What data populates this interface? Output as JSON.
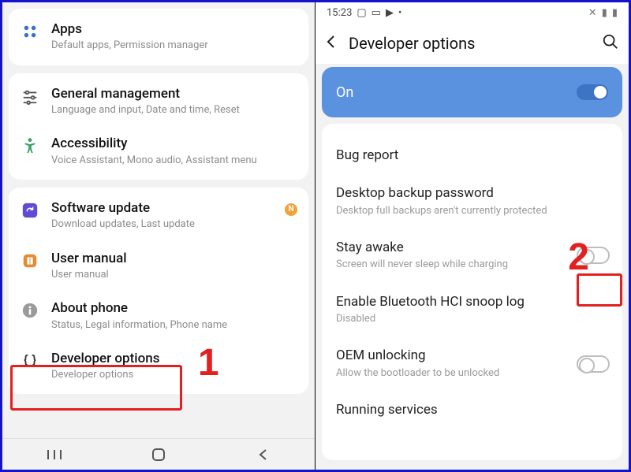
{
  "left": {
    "apps": {
      "title": "Apps",
      "sub": "Default apps, Permission manager"
    },
    "general": {
      "title": "General management",
      "sub": "Language and input, Date and time, Reset"
    },
    "accessibility": {
      "title": "Accessibility",
      "sub": "Voice Assistant, Mono audio, Assistant menu"
    },
    "software": {
      "title": "Software update",
      "sub": "Download updates, Last update",
      "badge": "N"
    },
    "manual": {
      "title": "User manual",
      "sub": "User manual"
    },
    "about": {
      "title": "About phone",
      "sub": "Status, Legal information, Phone name"
    },
    "developer": {
      "title": "Developer options",
      "sub": "Developer options"
    }
  },
  "right": {
    "status_time": "15:23",
    "appbar_title": "Developer options",
    "hero_label": "On",
    "items": {
      "bug": {
        "title": "Bug report"
      },
      "desktop": {
        "title": "Desktop backup password",
        "sub": "Desktop full backups aren't currently protected"
      },
      "stay": {
        "title": "Stay awake",
        "sub": "Screen will never sleep while charging"
      },
      "hci": {
        "title": "Enable Bluetooth HCI snoop log",
        "sub": "Disabled"
      },
      "oem": {
        "title": "OEM unlocking",
        "sub": "Allow the bootloader to be unlocked"
      },
      "running": {
        "title": "Running services"
      }
    }
  },
  "annotations": {
    "one": "1",
    "two": "2"
  }
}
